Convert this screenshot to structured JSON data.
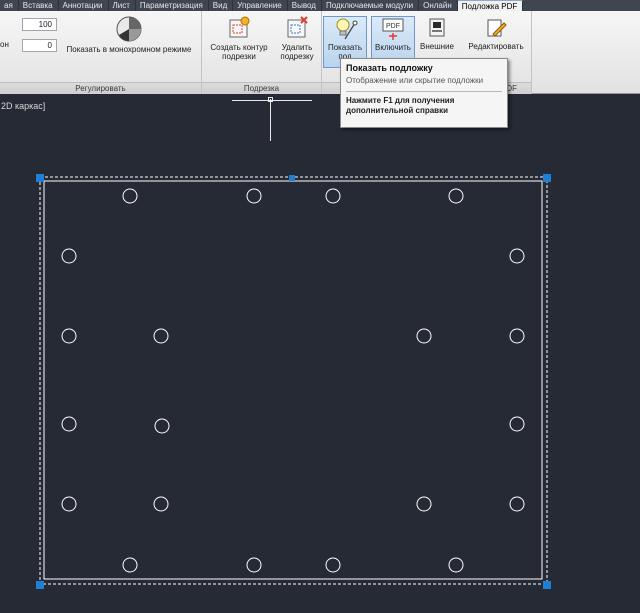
{
  "menu": {
    "tabs": [
      {
        "label": "ая",
        "active": false
      },
      {
        "label": "Вставка",
        "active": false
      },
      {
        "label": "Аннотации",
        "active": false
      },
      {
        "label": "Лист",
        "active": false
      },
      {
        "label": "Параметризация",
        "active": false
      },
      {
        "label": "Вид",
        "active": false
      },
      {
        "label": "Управление",
        "active": false
      },
      {
        "label": "Вывод",
        "active": false
      },
      {
        "label": "Подключаемые модули",
        "active": false
      },
      {
        "label": "Онлайн",
        "active": false
      },
      {
        "label": "Подложка PDF",
        "active": true
      }
    ]
  },
  "ribbon": {
    "adjust": {
      "field1_value": "100",
      "field2_label": "он",
      "field2_value": "0",
      "monochrome_label": "Показать в монохромном режиме",
      "title": "Регулировать"
    },
    "clip": {
      "create_label": "Создать контур\nподрезки",
      "remove_label": "Удалить\nподрезку",
      "title": "Подрезка"
    },
    "options": {
      "show_label": "Показать\nпод",
      "enable_label": "Включить",
      "external_label": "Внешние",
      "edit_label": "Редактировать",
      "title_fragment": "DF"
    }
  },
  "tooltip": {
    "title": "Показать подложку",
    "description": "Отображение или скрытие подложки",
    "help": "Нажмите F1 для получения дополнительной справки"
  },
  "viewport": {
    "label": "2D каркас]"
  },
  "colors": {
    "accent": "#1e7fd6",
    "canvas": "#252a34",
    "stroke": "#ffffff"
  }
}
